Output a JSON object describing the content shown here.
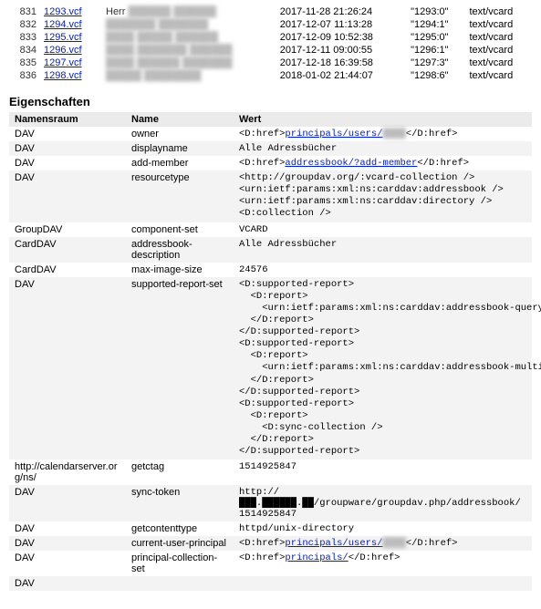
{
  "files": [
    {
      "idx": "831",
      "file": "1293.vcf",
      "who_prefix": "Herr",
      "who": "██████ ██████",
      "ts": "2017-11-28 21:26:24",
      "etag": "\"1293:0\"",
      "mime": "text/vcard"
    },
    {
      "idx": "832",
      "file": "1294.vcf",
      "who_prefix": "",
      "who": "███████ ███████",
      "ts": "2017-12-07 11:13:28",
      "etag": "\"1294:1\"",
      "mime": "text/vcard"
    },
    {
      "idx": "833",
      "file": "1295.vcf",
      "who_prefix": "",
      "who": "████ █████ ██████",
      "ts": "2017-12-09 10:52:38",
      "etag": "\"1295:0\"",
      "mime": "text/vcard"
    },
    {
      "idx": "834",
      "file": "1296.vcf",
      "who_prefix": "",
      "who": "████ ███████ ██████",
      "ts": "2017-12-11 09:00:55",
      "etag": "\"1296:1\"",
      "mime": "text/vcard"
    },
    {
      "idx": "835",
      "file": "1297.vcf",
      "who_prefix": "",
      "who": "████ ██████ ███████",
      "ts": "2017-12-18 16:39:58",
      "etag": "\"1297:3\"",
      "mime": "text/vcard"
    },
    {
      "idx": "836",
      "file": "1298.vcf",
      "who_prefix": "",
      "who": "█████ ████████",
      "ts": "2018-01-02 21:44:07",
      "etag": "\"1298:6\"",
      "mime": "text/vcard"
    }
  ],
  "heading": "Eigenschaften",
  "headers": {
    "ns": "Namensraum",
    "name": "Name",
    "value": "Wert"
  },
  "rows": [
    {
      "ns": "DAV",
      "name": "owner",
      "value_pre": "<D:href>",
      "link": "principals/users/",
      "link_suffix_blur": "████",
      "value_post": "</D:href>"
    },
    {
      "ns": "DAV",
      "name": "displayname",
      "value_plain": "Alle Adressbücher"
    },
    {
      "ns": "DAV",
      "name": "add-member",
      "value_pre": "<D:href>",
      "link": "addressbook/?add-member",
      "value_post": "</D:href>"
    },
    {
      "ns": "DAV",
      "name": "resourcetype",
      "value_block": "<http://groupdav.org/:vcard-collection />\n<urn:ietf:params:xml:ns:carddav:addressbook />\n<urn:ietf:params:xml:ns:carddav:directory />\n<D:collection />"
    },
    {
      "ns": "GroupDAV",
      "name": "component-set",
      "value_plain": "VCARD"
    },
    {
      "ns": "CardDAV",
      "name": "addressbook-description",
      "value_plain": "Alle Adressbücher"
    },
    {
      "ns": "CardDAV",
      "name": "max-image-size",
      "value_plain": "24576"
    },
    {
      "ns": "DAV",
      "name": "supported-report-set",
      "value_block": "<D:supported-report>\n  <D:report>\n    <urn:ietf:params:xml:ns:carddav:addressbook-query />\n  </D:report>\n</D:supported-report>\n<D:supported-report>\n  <D:report>\n    <urn:ietf:params:xml:ns:carddav:addressbook-multiget />\n  </D:report>\n</D:supported-report>\n<D:supported-report>\n  <D:report>\n    <D:sync-collection />\n  </D:report>\n</D:supported-report>"
    },
    {
      "ns": "http://calendarserver.org/ns/",
      "name": "getctag",
      "value_plain": "1514925847"
    },
    {
      "ns": "DAV",
      "name": "sync-token",
      "value_plain": "http://███.██████.██/groupware/groupdav.php/addressbook/1514925847"
    },
    {
      "ns": "DAV",
      "name": "getcontenttype",
      "value_plain": "httpd/unix-directory"
    },
    {
      "ns": "DAV",
      "name": "current-user-principal",
      "value_pre": "<D:href>",
      "link": "principals/users/",
      "link_suffix_blur": "████",
      "value_post": "</D:href>"
    },
    {
      "ns": "DAV",
      "name": "principal-collection-set",
      "value_pre": "<D:href>",
      "link": "principals/",
      "value_post": "</D:href>"
    },
    {
      "ns": "DAV",
      "name": "",
      "value_plain": ""
    }
  ]
}
